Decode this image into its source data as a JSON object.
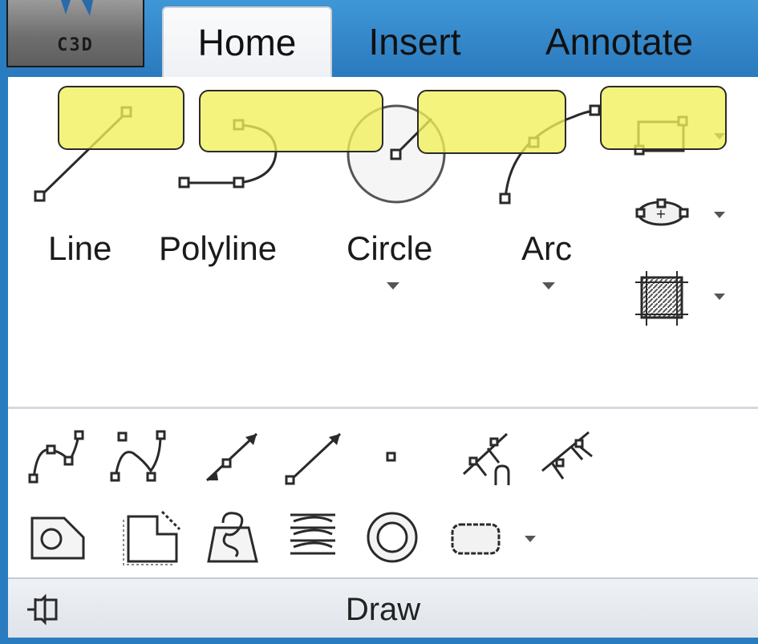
{
  "app_button": {
    "label": "C3D"
  },
  "tabs": [
    {
      "label": "Home",
      "active": true
    },
    {
      "label": "Insert",
      "active": false
    },
    {
      "label": "Annotate",
      "active": false
    }
  ],
  "draw_panel": {
    "title": "Draw",
    "large_tools": [
      {
        "label": "Line",
        "icon": "line-icon"
      },
      {
        "label": "Polyline",
        "icon": "polyline-icon"
      },
      {
        "label": "Circle",
        "icon": "circle-icon",
        "has_dropdown": true
      },
      {
        "label": "Arc",
        "icon": "arc-icon",
        "has_dropdown": true
      }
    ],
    "small_tools_right": [
      {
        "icon": "rectangle-icon",
        "has_dropdown": true
      },
      {
        "icon": "ellipse-icon",
        "has_dropdown": true
      },
      {
        "icon": "hatch-icon",
        "has_dropdown": true
      }
    ],
    "row1_tools": [
      "spline-fit-icon",
      "spline-cv-icon",
      "ray-icon",
      "construction-line-icon",
      "point-icon",
      "divide-icon",
      "measure-icon"
    ],
    "row2_tools": [
      "region-icon",
      "wipeout-icon",
      "revision-cloud-icon",
      "multiline-text-icon",
      "donut-icon",
      "boundary-icon"
    ],
    "row2_has_dropdown": true
  },
  "highlight_color": "#f0f05a",
  "frame_color": "#2a7cc0"
}
